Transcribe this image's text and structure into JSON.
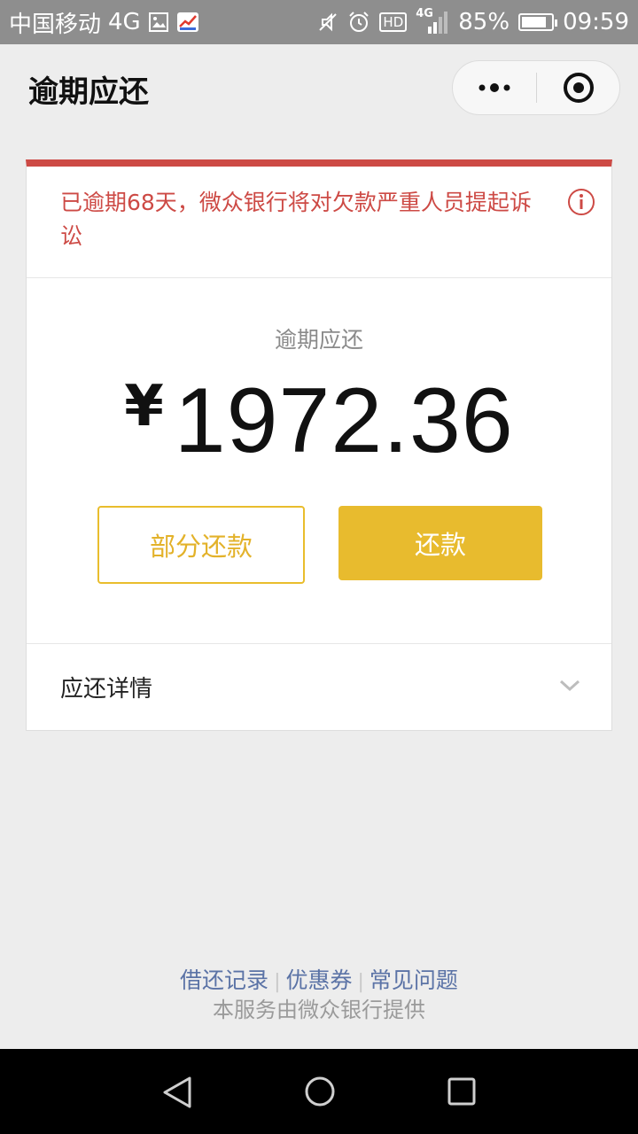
{
  "status_bar": {
    "carrier": "中国移动",
    "network": "4G",
    "hd_label": "HD",
    "signal_label": "4G",
    "battery_percent": "85%",
    "battery_level": 0.85,
    "time": "09:59"
  },
  "nav": {
    "title": "逾期应还"
  },
  "alert": {
    "message": "已逾期68天，微众银行将对欠款严重人员提起诉讼",
    "color": "#cd4a45"
  },
  "amount": {
    "label": "逾期应还",
    "currency": "¥",
    "value": "1972.36"
  },
  "buttons": {
    "partial_label": "部分还款",
    "repay_label": "还款",
    "accent": "#e8bb2e"
  },
  "details": {
    "label": "应还详情"
  },
  "footer": {
    "links": [
      "借还记录",
      "优惠券",
      "常见问题"
    ],
    "note": "本服务由微众银行提供"
  }
}
